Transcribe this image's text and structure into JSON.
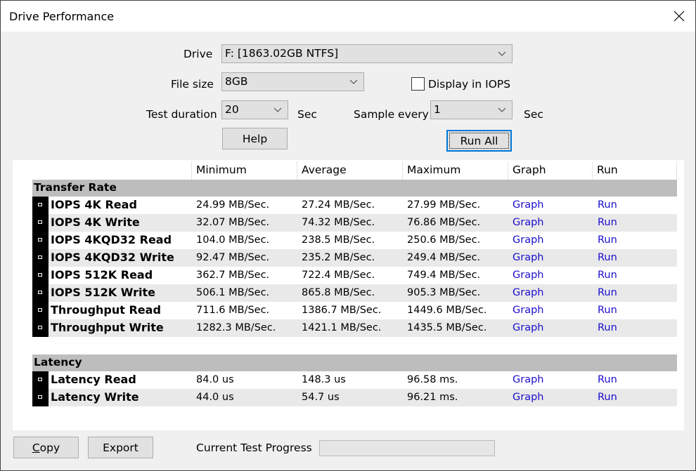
{
  "window": {
    "title": "Drive Performance",
    "close_icon": "close-icon"
  },
  "settings": {
    "drive_label": "Drive",
    "drive_value": "F: [1863.02GB NTFS]",
    "file_size_label": "File size",
    "file_size_value": "8GB",
    "display_iops_label": "Display in IOPS",
    "display_iops_checked": false,
    "test_duration_label": "Test duration",
    "test_duration_value": "20",
    "test_duration_unit": "Sec",
    "sample_every_label": "Sample every",
    "sample_every_value": "1",
    "sample_every_unit": "Sec",
    "help_button": "Help",
    "run_all_button": "Run All"
  },
  "table": {
    "columns": [
      "Minimum",
      "Average",
      "Maximum",
      "Graph",
      "Run"
    ],
    "sections": [
      {
        "title": "Transfer Rate",
        "rows": [
          {
            "name": "IOPS 4K Read",
            "min": "24.99 MB/Sec.",
            "avg": "27.24 MB/Sec.",
            "max": "27.99 MB/Sec.",
            "graph": "Graph",
            "run": "Run"
          },
          {
            "name": "IOPS 4K Write",
            "min": "32.07 MB/Sec.",
            "avg": "74.32 MB/Sec.",
            "max": "76.86 MB/Sec.",
            "graph": "Graph",
            "run": "Run"
          },
          {
            "name": "IOPS 4KQD32 Read",
            "min": "104.0 MB/Sec.",
            "avg": "238.5 MB/Sec.",
            "max": "250.6 MB/Sec.",
            "graph": "Graph",
            "run": "Run"
          },
          {
            "name": "IOPS 4KQD32 Write",
            "min": "92.47 MB/Sec.",
            "avg": "235.2 MB/Sec.",
            "max": "249.4 MB/Sec.",
            "graph": "Graph",
            "run": "Run"
          },
          {
            "name": "IOPS 512K Read",
            "min": "362.7 MB/Sec.",
            "avg": "722.4 MB/Sec.",
            "max": "749.4 MB/Sec.",
            "graph": "Graph",
            "run": "Run"
          },
          {
            "name": "IOPS 512K Write",
            "min": "506.1 MB/Sec.",
            "avg": "865.8 MB/Sec.",
            "max": "905.3 MB/Sec.",
            "graph": "Graph",
            "run": "Run"
          },
          {
            "name": "Throughput Read",
            "min": "711.6 MB/Sec.",
            "avg": "1386.7 MB/Sec.",
            "max": "1449.6 MB/Sec.",
            "graph": "Graph",
            "run": "Run"
          },
          {
            "name": "Throughput Write",
            "min": "1282.3 MB/Sec.",
            "avg": "1421.1 MB/Sec.",
            "max": "1435.5 MB/Sec.",
            "graph": "Graph",
            "run": "Run"
          }
        ]
      },
      {
        "title": "Latency",
        "rows": [
          {
            "name": "Latency Read",
            "min": "84.0 us",
            "avg": "148.3 us",
            "max": "96.58 ms.",
            "graph": "Graph",
            "run": "Run"
          },
          {
            "name": "Latency Write",
            "min": "44.0 us",
            "avg": "54.7 us",
            "max": "96.21 ms.",
            "graph": "Graph",
            "run": "Run"
          }
        ]
      }
    ]
  },
  "footer": {
    "copy_button_accel": "C",
    "copy_button_rest": "opy",
    "export_button": "Export",
    "progress_label": "Current Test Progress",
    "progress_value": 0
  },
  "colors": {
    "link": "#1a0dcc",
    "section_bg": "#bdbdbd",
    "alt_row": "#e9e9e9",
    "focus": "#0078d7"
  }
}
